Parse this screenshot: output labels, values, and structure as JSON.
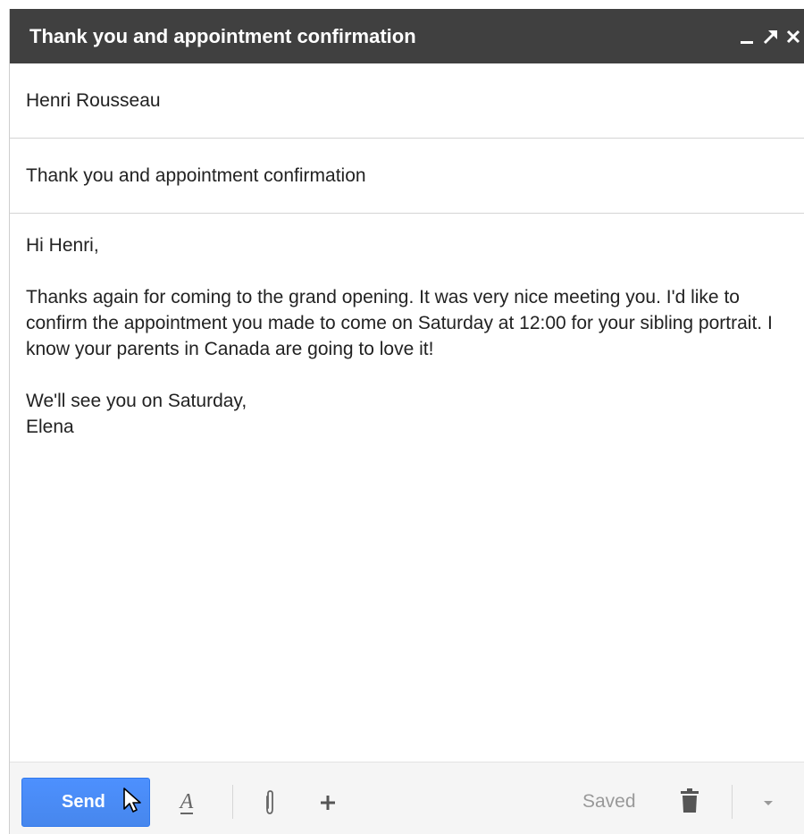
{
  "window": {
    "title": "Thank you and appointment confirmation",
    "controls": {
      "minimize": "minimize-icon",
      "popout": "popout-icon",
      "close": "close-icon"
    }
  },
  "to": {
    "value": "Henri Rousseau"
  },
  "subject": {
    "value": "Thank you and appointment confirmation"
  },
  "body": {
    "greeting": "Hi Henri,",
    "paragraph": "Thanks again for coming to the grand opening. It was very nice meeting you. I'd like to confirm the appointment you made to come on Saturday at 12:00 for your sibling portrait. I know your parents in Canada are going to love it!",
    "closing": "We'll see you on Saturday,",
    "signature": "Elena"
  },
  "toolbar": {
    "send_label": "Send",
    "saved_label": "Saved",
    "icons": [
      "text-format-icon",
      "attach-icon",
      "plus-icon",
      "trash-icon",
      "more-options-icon"
    ]
  },
  "colors": {
    "titlebar": "#404040",
    "send": "#4d90fe"
  }
}
